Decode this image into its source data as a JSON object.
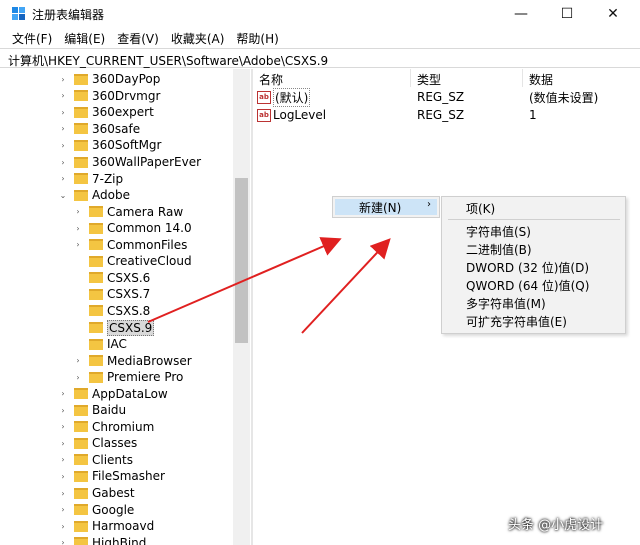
{
  "window": {
    "title": "注册表编辑器",
    "min_icon": "—",
    "max_icon": "☐",
    "close_icon": "✕"
  },
  "menu": [
    "文件(F)",
    "编辑(E)",
    "查看(V)",
    "收藏夹(A)",
    "帮助(H)"
  ],
  "address": "计算机\\HKEY_CURRENT_USER\\Software\\Adobe\\CSXS.9",
  "tree": [
    {
      "label": "360DayPop",
      "expander": "›",
      "indent": 1
    },
    {
      "label": "360Drvmgr",
      "expander": "›",
      "indent": 1
    },
    {
      "label": "360expert",
      "expander": "›",
      "indent": 1
    },
    {
      "label": "360safe",
      "expander": "›",
      "indent": 1
    },
    {
      "label": "360SoftMgr",
      "expander": "›",
      "indent": 1
    },
    {
      "label": "360WallPaperEver",
      "expander": "›",
      "indent": 1
    },
    {
      "label": "7-Zip",
      "expander": "›",
      "indent": 1
    },
    {
      "label": "Adobe",
      "expander": "⌄",
      "indent": 1
    },
    {
      "label": "Camera Raw",
      "expander": "›",
      "indent": 2
    },
    {
      "label": "Common 14.0",
      "expander": "›",
      "indent": 2
    },
    {
      "label": "CommonFiles",
      "expander": "›",
      "indent": 2
    },
    {
      "label": "CreativeCloud",
      "expander": "",
      "indent": 2
    },
    {
      "label": "CSXS.6",
      "expander": "",
      "indent": 2
    },
    {
      "label": "CSXS.7",
      "expander": "",
      "indent": 2
    },
    {
      "label": "CSXS.8",
      "expander": "",
      "indent": 2
    },
    {
      "label": "CSXS.9",
      "expander": "",
      "indent": 2,
      "selected": true
    },
    {
      "label": "IAC",
      "expander": "",
      "indent": 2
    },
    {
      "label": "MediaBrowser",
      "expander": "›",
      "indent": 2
    },
    {
      "label": "Premiere Pro",
      "expander": "›",
      "indent": 2
    },
    {
      "label": "AppDataLow",
      "expander": "›",
      "indent": 1
    },
    {
      "label": "Baidu",
      "expander": "›",
      "indent": 1
    },
    {
      "label": "Chromium",
      "expander": "›",
      "indent": 1
    },
    {
      "label": "Classes",
      "expander": "›",
      "indent": 1
    },
    {
      "label": "Clients",
      "expander": "›",
      "indent": 1
    },
    {
      "label": "FileSmasher",
      "expander": "›",
      "indent": 1
    },
    {
      "label": "Gabest",
      "expander": "›",
      "indent": 1
    },
    {
      "label": "Google",
      "expander": "›",
      "indent": 1
    },
    {
      "label": "Harmoavd",
      "expander": "›",
      "indent": 1
    },
    {
      "label": "HighBind",
      "expander": "›",
      "indent": 1
    }
  ],
  "list": {
    "headers": {
      "name": "名称",
      "type": "类型",
      "data": "数据"
    },
    "rows": [
      {
        "name": "(默认)",
        "type": "REG_SZ",
        "data": "(数值未设置)",
        "icon": "string-value-icon",
        "is_default": true
      },
      {
        "name": "LogLevel",
        "type": "REG_SZ",
        "data": "1",
        "icon": "string-value-icon"
      }
    ]
  },
  "context_menu": {
    "new_label": "新建(N)",
    "new_chevron": "›",
    "submenu": [
      "项(K)",
      "字符串值(S)",
      "二进制值(B)",
      "DWORD (32 位)值(D)",
      "QWORD (64 位)值(Q)",
      "多字符串值(M)",
      "可扩充字符串值(E)"
    ]
  },
  "watermark": "头条 @小虎设计",
  "colors": {
    "arrow": "#e02020",
    "folder": "#f4c542",
    "highlight": "#cde4f7"
  }
}
